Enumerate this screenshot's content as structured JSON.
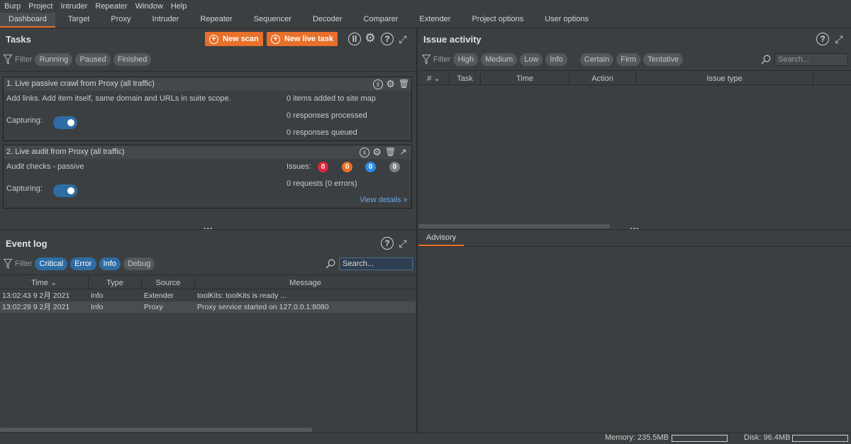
{
  "menu": [
    "Burp",
    "Project",
    "Intruder",
    "Repeater",
    "Window",
    "Help"
  ],
  "tabs": [
    "Dashboard",
    "Target",
    "Proxy",
    "Intruder",
    "Repeater",
    "Sequencer",
    "Decoder",
    "Comparer",
    "Extender",
    "Project options",
    "User options"
  ],
  "tasks": {
    "title": "Tasks",
    "new_scan": "New scan",
    "new_live_task": "New live task",
    "filter_label": "Filter",
    "filters": [
      "Running",
      "Paused",
      "Finished"
    ],
    "task1": {
      "title": "1. Live passive crawl from Proxy (all traffic)",
      "description": "Add links. Add item itself, same domain and URLs in suite scope.",
      "capturing_label": "Capturing:",
      "stat1": "0 items added to site map",
      "stat2": "0 responses processed",
      "stat3": "0 responses queued"
    },
    "task2": {
      "title": "2. Live audit from Proxy (all traffic)",
      "description": "Audit checks - passive",
      "capturing_label": "Capturing:",
      "issues_label": "Issues:",
      "issue_counts": [
        "0",
        "0",
        "0",
        "0"
      ],
      "issue_colors": [
        "#e0263c",
        "#e8702a",
        "#2b8ce8",
        "#7d8085"
      ],
      "requests": "0 requests (0 errors)",
      "view_details": "View details"
    }
  },
  "issue_activity": {
    "title": "Issue activity",
    "filter_label": "Filter",
    "severity_filters": [
      "High",
      "Medium",
      "Low",
      "Info"
    ],
    "confidence_filters": [
      "Certain",
      "Firm",
      "Tentative"
    ],
    "search_placeholder": "Search...",
    "columns": [
      "#",
      "Task",
      "Time",
      "Action",
      "Issue type"
    ]
  },
  "advisory": {
    "tab": "Advisory"
  },
  "event_log": {
    "title": "Event log",
    "filter_label": "Filter",
    "filters": [
      "Critical",
      "Error",
      "Info",
      "Debug"
    ],
    "search_placeholder": "Search...",
    "columns": [
      "Time",
      "Type",
      "Source",
      "Message"
    ],
    "rows": [
      {
        "time": "13:02:43 9 2月 2021",
        "type": "Info",
        "source": "Extender",
        "message": "toolKits: toolKits is ready ..."
      },
      {
        "time": "13:02:29 9 2月 2021",
        "type": "Info",
        "source": "Proxy",
        "message": "Proxy service started on 127.0.0.1:8080"
      }
    ]
  },
  "status": {
    "memory_label": "Memory: 235.5MB",
    "disk_label": "Disk: 96.4MB",
    "memory_fraction": 0.0,
    "disk_fraction": 0.0
  }
}
